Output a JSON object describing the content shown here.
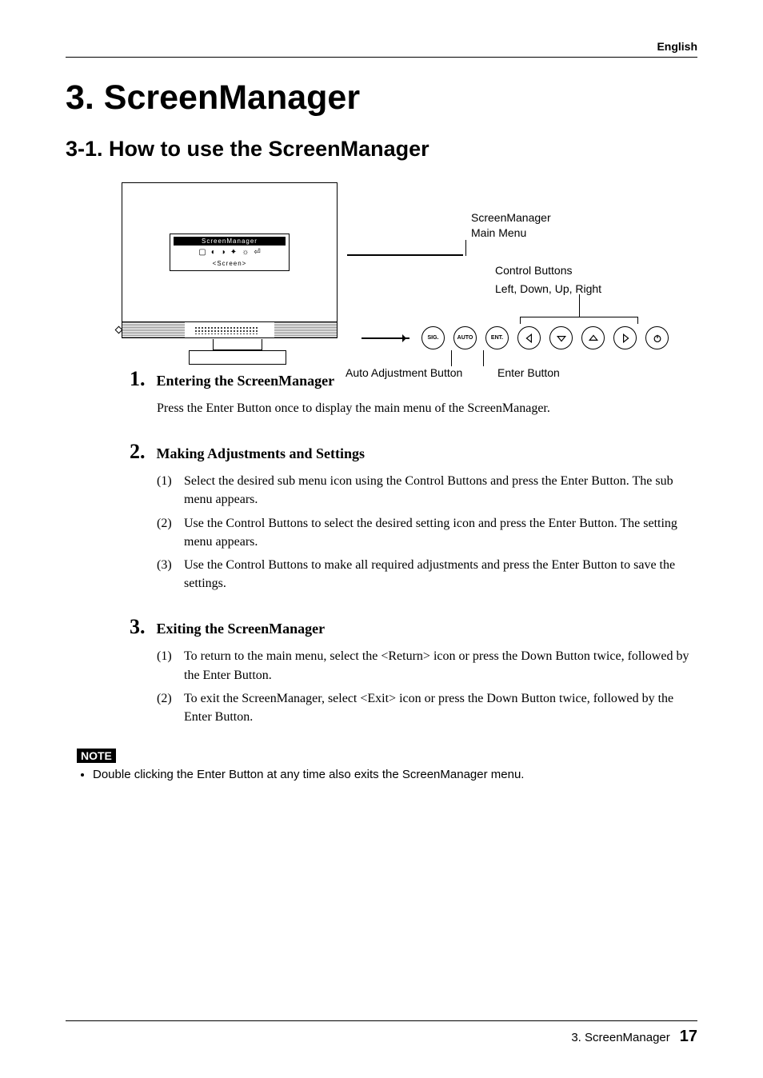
{
  "header": {
    "lang": "English"
  },
  "chapter": {
    "title": "3. ScreenManager"
  },
  "section": {
    "title": "3-1. How to use the ScreenManager"
  },
  "diagram": {
    "osd": {
      "title": "ScreenManager",
      "status": "<Screen>"
    },
    "annot": {
      "main1": "ScreenManager",
      "main2": "Main Menu",
      "ctrl": "Control Buttons",
      "ctrl_sub": "Left, Down, Up, Right",
      "auto": "Auto Adjustment Button",
      "enter": "Enter Button"
    },
    "buttons": {
      "sig": "SIG.",
      "auto": "AUTO",
      "ent": "ENT."
    }
  },
  "steps": [
    {
      "num": "1.",
      "title": "Entering the ScreenManager",
      "paras": [
        "Press the Enter Button once to display the main menu of the ScreenManager."
      ]
    },
    {
      "num": "2.",
      "title": "Making Adjustments and Settings",
      "items": [
        {
          "n": "(1)",
          "t": "Select the desired sub menu icon using the Control Buttons and press the Enter Button. The sub menu appears."
        },
        {
          "n": "(2)",
          "t": "Use the Control Buttons to select the desired setting icon and press the Enter Button. The setting menu appears."
        },
        {
          "n": "(3)",
          "t": "Use the Control Buttons to make all required adjustments and press the Enter Button to save the settings."
        }
      ]
    },
    {
      "num": "3.",
      "title": "Exiting the ScreenManager",
      "items": [
        {
          "n": "(1)",
          "t": "To return to the main menu, select the <Return> icon or press the Down Button twice, followed by the Enter Button."
        },
        {
          "n": "(2)",
          "t": "To exit the ScreenManager, select <Exit> icon or press the Down Button twice, followed by the Enter Button."
        }
      ]
    }
  ],
  "note": {
    "label": "NOTE",
    "items": [
      "Double clicking the Enter Button at any time also exits the ScreenManager menu."
    ]
  },
  "footer": {
    "chapter": "3. ScreenManager",
    "page": "17"
  }
}
